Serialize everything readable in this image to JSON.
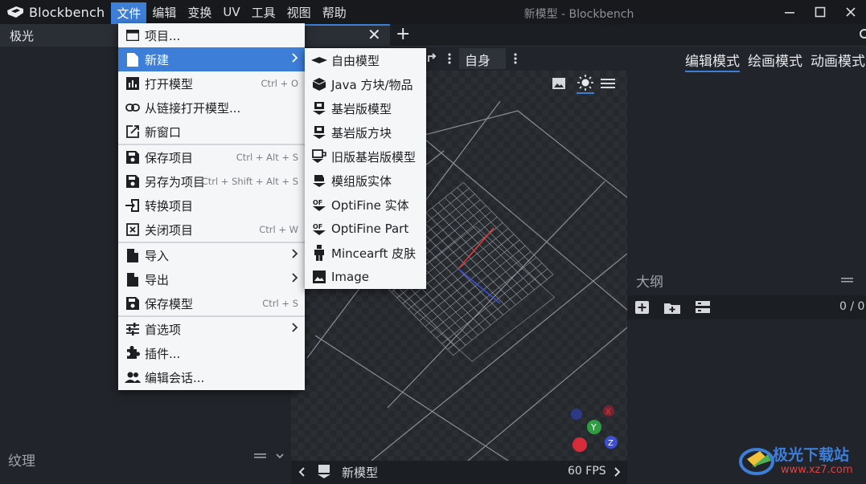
{
  "app": {
    "name": "Blockbench",
    "window_title": "新模型 - Blockbench"
  },
  "menubar": [
    "文件",
    "编辑",
    "变换",
    "UV",
    "工具",
    "视图",
    "帮助"
  ],
  "tabs": {
    "left_tab": "极光",
    "close": "✕",
    "add": "+"
  },
  "file_menu": {
    "items": [
      {
        "label": "项目...",
        "shortcut": "",
        "submenu": false,
        "icon": "project-icon"
      },
      {
        "label": "新建",
        "shortcut": "",
        "submenu": true,
        "icon": "new-file-icon"
      },
      {
        "label": "打开模型",
        "shortcut": "Ctrl + O",
        "submenu": false,
        "icon": "open-model-icon"
      },
      {
        "label": "从链接打开模型...",
        "shortcut": "",
        "submenu": false,
        "icon": "link-icon"
      },
      {
        "label": "新窗口",
        "shortcut": "",
        "submenu": false,
        "icon": "new-window-icon"
      },
      {
        "label": "保存项目",
        "shortcut": "Ctrl + Alt + S",
        "submenu": false,
        "icon": "save-icon"
      },
      {
        "label": "另存为项目",
        "shortcut": "Ctrl + Shift + Alt + S",
        "submenu": false,
        "icon": "save-as-icon"
      },
      {
        "label": "转换项目",
        "shortcut": "",
        "submenu": false,
        "icon": "convert-icon"
      },
      {
        "label": "关闭项目",
        "shortcut": "Ctrl + W",
        "submenu": false,
        "icon": "close-project-icon"
      },
      {
        "label": "导入",
        "shortcut": "",
        "submenu": true,
        "icon": "import-icon"
      },
      {
        "label": "导出",
        "shortcut": "",
        "submenu": true,
        "icon": "export-icon"
      },
      {
        "label": "保存模型",
        "shortcut": "Ctrl + S",
        "submenu": false,
        "icon": "save-model-icon"
      },
      {
        "label": "首选项",
        "shortcut": "",
        "submenu": true,
        "icon": "preferences-icon"
      },
      {
        "label": "插件...",
        "shortcut": "",
        "submenu": false,
        "icon": "plugin-icon"
      },
      {
        "label": "编辑会话...",
        "shortcut": "",
        "submenu": false,
        "icon": "people-icon"
      }
    ]
  },
  "new_menu": {
    "items": [
      {
        "label": "自由模型",
        "icon": "free-model-icon"
      },
      {
        "label": "Java 方块/物品",
        "icon": "java-block-icon"
      },
      {
        "label": "基岩版模型",
        "icon": "bedrock-model-icon"
      },
      {
        "label": "基岩版方块",
        "icon": "bedrock-block-icon"
      },
      {
        "label": "旧版基岩版模型",
        "icon": "legacy-bedrock-icon"
      },
      {
        "label": "模组版实体",
        "icon": "modded-entity-icon"
      },
      {
        "label": "OptiFine 实体",
        "icon": "optifine-entity-icon"
      },
      {
        "label": "OptiFine Part",
        "icon": "optifine-part-icon"
      },
      {
        "label": "Mincearft 皮肤",
        "icon": "skin-icon"
      },
      {
        "label": "Image",
        "icon": "image-icon"
      }
    ]
  },
  "viewport": {
    "self_dropdown": "自身",
    "model_name": "新模型",
    "fps": "60 FPS",
    "gizmo": {
      "x": "X",
      "y": "Y",
      "z": "Z"
    }
  },
  "right": {
    "modes": [
      "编辑模式",
      "绘画模式",
      "动画模式"
    ],
    "outline_title": "大纲",
    "outline_count": "0 / 0"
  },
  "left": {
    "texture_title": "纹理"
  },
  "watermark": {
    "text": "极光下载站",
    "url": "www.xz7.com"
  },
  "colors": {
    "accent": "#3d7ed9",
    "menu_bg": "#f5f6f7",
    "axis_x": "#e53935",
    "axis_y": "#2e9d42",
    "axis_z": "#3b4fd8"
  }
}
